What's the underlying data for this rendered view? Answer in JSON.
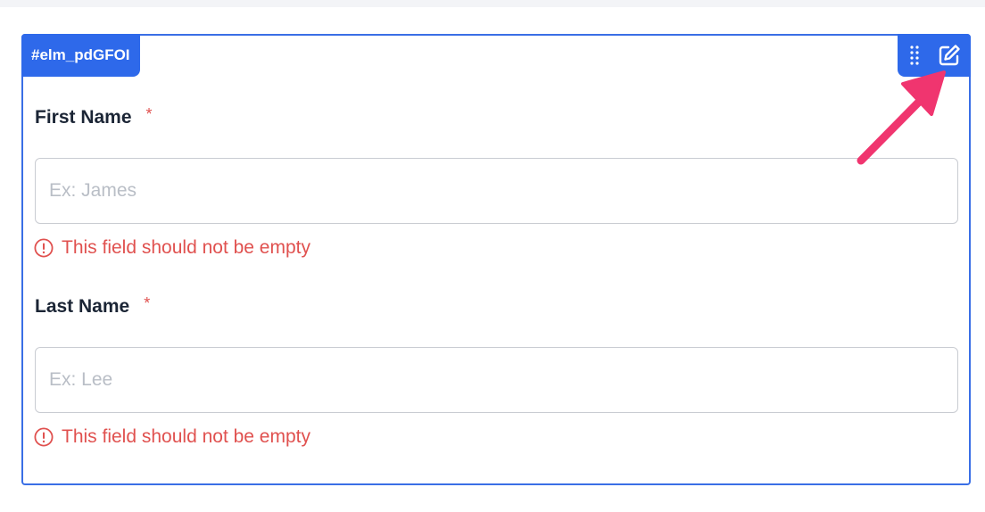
{
  "element_tag": "#elm_pdGFOI",
  "toolbar": {
    "drag_icon": "drag-handle-icon",
    "edit_icon": "edit-icon"
  },
  "fields": [
    {
      "label": "First Name",
      "required_marker": "*",
      "placeholder": "Ex: James",
      "value": "",
      "error": "This field should not be empty"
    },
    {
      "label": "Last Name",
      "required_marker": "*",
      "placeholder": "Ex: Lee",
      "value": "",
      "error": "This field should not be empty"
    }
  ],
  "colors": {
    "accent": "#2e69ea",
    "error": "#e0514f",
    "annotation_arrow": "#f0356f"
  }
}
